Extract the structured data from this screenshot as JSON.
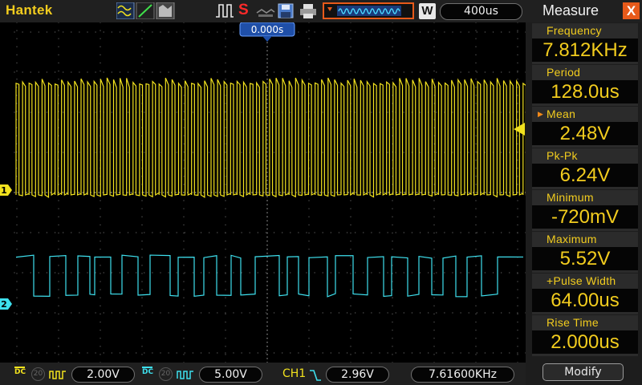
{
  "header": {
    "brand": "Hantek",
    "run_state": "S",
    "w_label": "W",
    "timebase": "400us"
  },
  "plot": {
    "trigger_position": "0.000s",
    "ch1_marker": "1",
    "ch2_marker": "2",
    "ch1_color": "#f2e21e",
    "ch2_color": "#3ee0ee"
  },
  "bottom": {
    "ch1_volts": "2.00V",
    "ch2_volts": "5.00V",
    "trigger_source": "CH1",
    "trigger_level": "2.96V",
    "frequency": "7.61600KHz",
    "ch1_coupling": "DC",
    "ch2_coupling": "DC",
    "ch1_bw": "20",
    "ch2_bw": "20"
  },
  "measure": {
    "title": "Measure",
    "close": "X",
    "items": [
      {
        "label": "Frequency",
        "value": "7.812KHz"
      },
      {
        "label": "Period",
        "value": "128.0us"
      },
      {
        "label": "Mean",
        "value": "2.48V"
      },
      {
        "label": "Pk-Pk",
        "value": "6.24V"
      },
      {
        "label": "Minimum",
        "value": "-720mV"
      },
      {
        "label": "Maximum",
        "value": "5.52V"
      },
      {
        "label": "+Pulse Width",
        "value": "64.00us"
      },
      {
        "label": "Rise Time",
        "value": "2.000us"
      }
    ],
    "modify_label": "Modify"
  },
  "colors": {
    "accent": "#f2cc1e",
    "close": "#e85a1a",
    "run_stop": "#ff2a2a",
    "timebase_icon": "#e85a1a"
  }
}
